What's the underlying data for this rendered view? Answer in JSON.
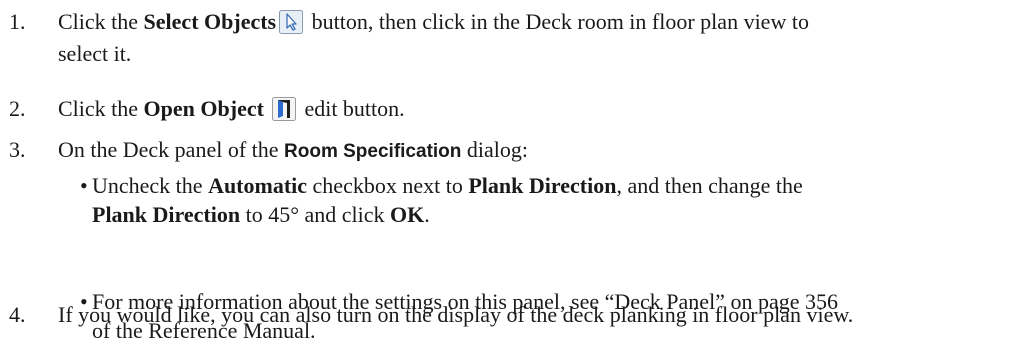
{
  "steps": [
    {
      "num": "1.",
      "pre": "Click the ",
      "bold": "Select Objects",
      "icon": "select-objects-arrow-icon",
      "post": " button, then click in the Deck room in floor plan view to",
      "line2": "select it."
    },
    {
      "num": "2.",
      "pre": "Click the ",
      "bold": "Open Object",
      "icon": "open-object-door-icon",
      "post": " edit button."
    },
    {
      "num": "3.",
      "pre": "On the Deck panel of the ",
      "bold": "Room Specification",
      "post": " dialog:",
      "bullets": [
        {
          "t1": "Uncheck the ",
          "b1": "Automatic",
          "t2": " checkbox next to ",
          "b2": "Plank Direction",
          "t3": ", and then change the",
          "b3": "Plank Direction",
          "t4": " to 45° and click ",
          "b4": "OK",
          "t5": "."
        },
        {
          "line1": "For more information about the settings on this panel, see “Deck Panel” on page 356",
          "line2": "of the Reference Manual."
        }
      ]
    },
    {
      "num": "4.",
      "text": "If you would like, you can also turn on the display of the deck planking in floor plan view."
    }
  ],
  "bullet_char": "•"
}
